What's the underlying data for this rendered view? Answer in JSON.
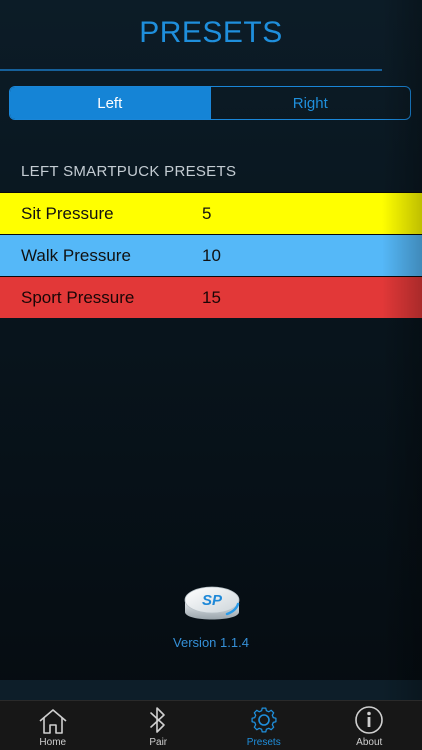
{
  "page": {
    "title": "PRESETS"
  },
  "segment": {
    "left_label": "Left",
    "right_label": "Right",
    "selected": "Left"
  },
  "section": {
    "heading": "LEFT SMARTPUCK PRESETS"
  },
  "presets": [
    {
      "name": "Sit Pressure",
      "value": "5",
      "color": "#ffff00"
    },
    {
      "name": "Walk Pressure",
      "value": "10",
      "color": "#55b8f8"
    },
    {
      "name": "Sport Pressure",
      "value": "15",
      "color": "#e23838"
    }
  ],
  "footer": {
    "logo_text": "SP",
    "version": "Version 1.1.4"
  },
  "tabbar": {
    "items": [
      {
        "label": "Home",
        "icon": "home-icon"
      },
      {
        "label": "Pair",
        "icon": "bluetooth-icon"
      },
      {
        "label": "Presets",
        "icon": "gear-icon",
        "active": true
      },
      {
        "label": "About",
        "icon": "info-icon"
      }
    ]
  },
  "colors": {
    "accent": "#1f8fdc",
    "background": "#08141c"
  }
}
